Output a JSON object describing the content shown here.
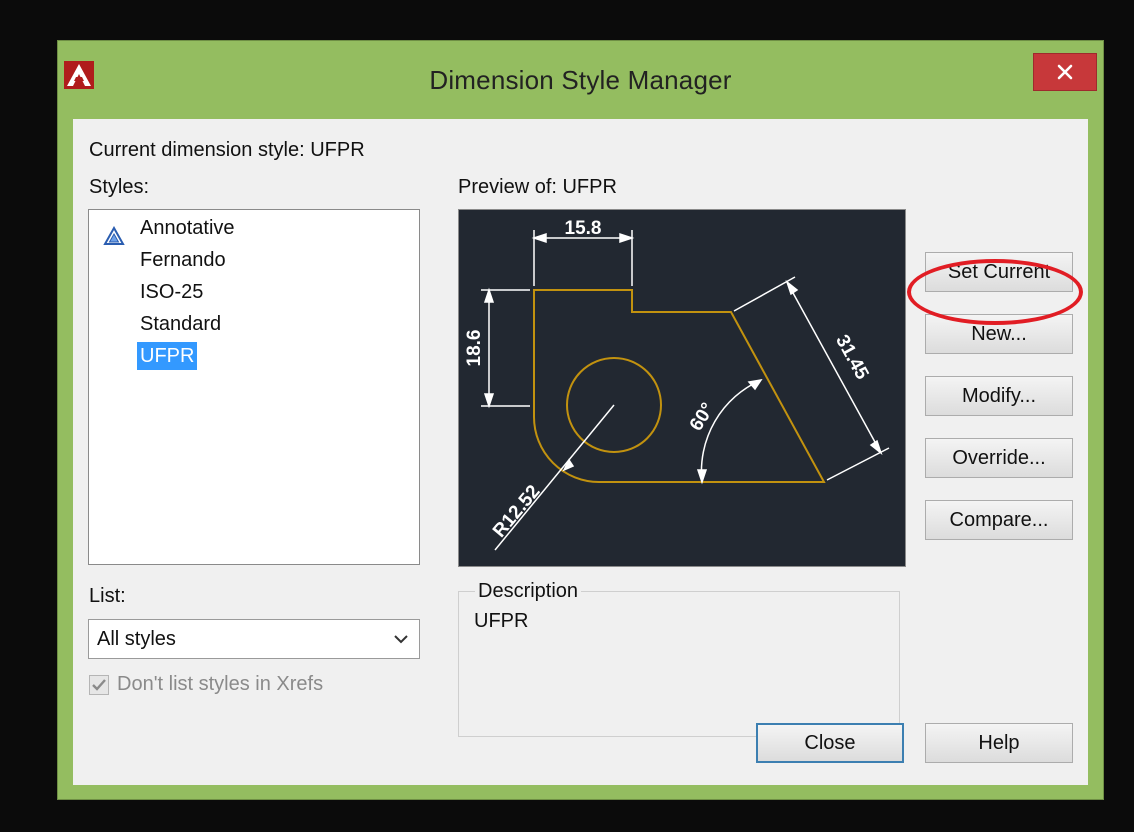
{
  "window": {
    "title": "Dimension Style Manager",
    "app_icon": "autocad-logo-icon",
    "close_icon": "close-icon",
    "accent_color": "#94bd60"
  },
  "current_style": "Current dimension style: UFPR",
  "styles_label": "Styles:",
  "styles": {
    "annotative": "Annotative",
    "fernando": "Fernando",
    "iso25": "ISO-25",
    "standard": "Standard",
    "ufpr": "UFPR",
    "selected": "UFPR"
  },
  "preview": {
    "label": "Preview of: UFPR",
    "dims": {
      "top": "15.8",
      "left": "18.6",
      "slant": "31.45",
      "angle": "60°",
      "radius": "R12.52"
    },
    "line_color": "#c2920f",
    "dim_color": "#ffffff",
    "bg_color": "#222831"
  },
  "buttons": {
    "set_current": "Set Current",
    "new": "New...",
    "modify": "Modify...",
    "override": "Override...",
    "compare": "Compare...",
    "close": "Close",
    "help": "Help"
  },
  "list": {
    "label": "List:",
    "value": "All styles"
  },
  "checkbox": {
    "label": "Don't list styles in Xrefs",
    "checked": true
  },
  "description": {
    "legend": "Description",
    "text": "UFPR"
  }
}
